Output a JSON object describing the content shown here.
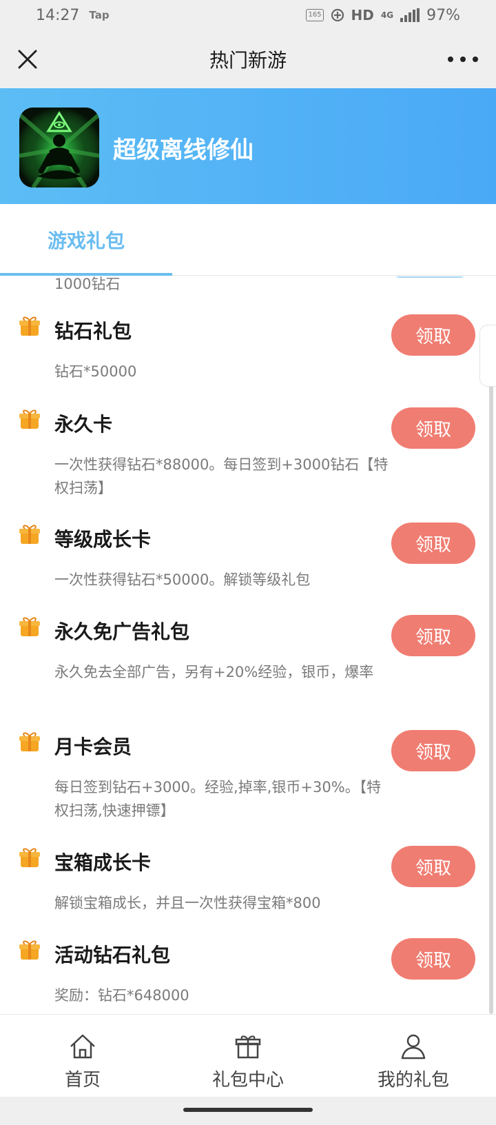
{
  "status_bar": {
    "time": "14:27",
    "tap_label": "Tap",
    "hz_badge": "165",
    "hd": "HD",
    "network": "4G",
    "battery": "97%"
  },
  "title_bar": {
    "title": "热门新游"
  },
  "banner": {
    "game_name": "超级离线修仙"
  },
  "tabs": {
    "active": "游戏礼包"
  },
  "list": {
    "top_partial_desc": "1000钻石",
    "items": [
      {
        "title": "钻石礼包",
        "desc": "钻石*50000",
        "button": "领取"
      },
      {
        "title": "永久卡",
        "desc": "一次性获得钻石*88000。每日签到+3000钻石【特权扫荡】",
        "button": "领取"
      },
      {
        "title": "等级成长卡",
        "desc": "一次性获得钻石*50000。解锁等级礼包",
        "button": "领取"
      },
      {
        "title": "永久免广告礼包",
        "desc": "永久免去全部广告，另有+20%经验，银币，爆率",
        "button": "领取"
      },
      {
        "title": "月卡会员",
        "desc": "每日签到钻石+3000。经验,掉率,银币+30%。【特权扫荡,快速押镖】",
        "button": "领取"
      },
      {
        "title": "宝箱成长卡",
        "desc": "解锁宝箱成长，并且一次性获得宝箱*800",
        "button": "领取"
      },
      {
        "title": "活动钻石礼包",
        "desc": "奖励：钻石*648000",
        "button": "领取"
      }
    ]
  },
  "bottom_nav": {
    "home": "首页",
    "gift_center": "礼包中心",
    "my_gifts": "我的礼包"
  },
  "colors": {
    "accent": "#6bbdf0",
    "button": "#f07d72",
    "banner_start": "#5cbdf5",
    "banner_end": "#4aa9f6"
  }
}
